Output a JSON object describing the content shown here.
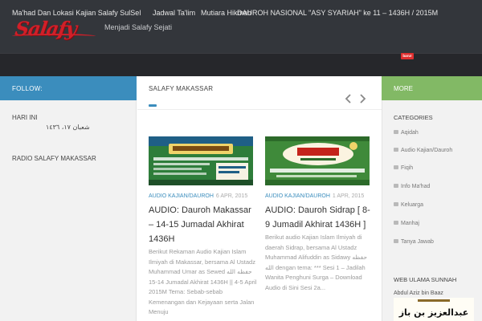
{
  "header": {
    "logo_text": "Salafy",
    "tagline": "Menjadi Salafy Sejati"
  },
  "nav": {
    "items": [
      "Ma'had Dan Lokasi Kajian Salafy SulSel",
      "Jadwal Ta'lim",
      "Mutiara Hikmah",
      "DAUROH NASIONAL \"ASY SYARIAH\" ke 11 – 1436H / 2015M"
    ],
    "badge": "baru!"
  },
  "left_sidebar": {
    "follow_label": "FOLLOW:",
    "widgets": [
      {
        "title": "HARI INI",
        "content": "شعبان ١٧، ١٤٣٦"
      },
      {
        "title": "RADIO SALAFY MAKASSAR"
      }
    ]
  },
  "main": {
    "section_title": "SALAFY MAKASSAR",
    "posts": [
      {
        "category": "AUDIO KAJIAN/DAUROH",
        "date": "6 APR, 2015",
        "title": "AUDIO: Dauroh Makassar – 14-15 Jumadal Akhirat 1436H",
        "excerpt": "Berikut Rekaman Audio Kajian Islam Ilmiyah di Makassar, bersama Al Ustadz Muhammad Umar as Sewed حفظه الله 14-15 Jumadal Akhirat 1436H || 4-5 April 2015M Tema: Sebab-sebab Kemenangan dan Kejayaan serta Jalan Menuju"
      },
      {
        "category": "AUDIO KAJIAN/DAUROH",
        "date": "1 APR, 2015",
        "title": "AUDIO: Dauroh Sidrap [ 8-9 Jumadil Akhirat 1436H ]",
        "excerpt": "Berikut audio Kajian Islam Ilmiyah di daerah Sidrap, bersama Al Ustadz Muhammad Alifuddin as Sidawy حفظه الله dengan tema: *** Sesi 1 – Jadilah Wanita Penghuni Surga – Download Audio di Sini Sesi 2a..."
      }
    ]
  },
  "right_sidebar": {
    "more_label": "MORE",
    "categories_heading": "CATEGORIES",
    "categories": [
      "Aqidah",
      "Audio Kajian/Dauroh",
      "Fiqih",
      "Info Ma'had",
      "Keluarga",
      "Manhaj",
      "Tanya Jawab"
    ],
    "web_ulama_heading": "WEB ULAMA SUNNAH",
    "ulama_name": "Abdul Aziz bin Baaz",
    "ulama_art_text": "عبدالعزيز بن عبدالله بن باز"
  },
  "colors": {
    "header_bg": "#33363b",
    "nav_bg": "#26272b",
    "follow_blue": "#3b8dbd",
    "more_green": "#82b965",
    "logo_red": "#d11f28"
  }
}
